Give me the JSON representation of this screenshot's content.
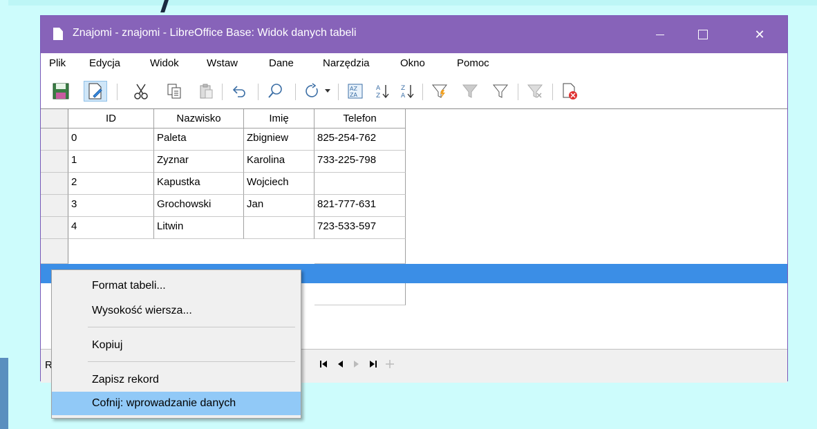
{
  "window": {
    "title": "Znajomi - znajomi - LibreOffice Base: Widok danych tabeli",
    "controls": {
      "minimize": "—",
      "maximize": "☐",
      "close": "✕"
    }
  },
  "menubar": {
    "items": [
      "Plik",
      "Edycja",
      "Widok",
      "Wstaw",
      "Dane",
      "Narzędzia",
      "Okno",
      "Pomoc"
    ]
  },
  "toolbar": {
    "icons": [
      "save-record-icon",
      "edit-data-icon",
      "cut-icon",
      "copy-icon",
      "paste-icon",
      "undo-icon",
      "find-icon",
      "refresh-icon",
      "dropdown-arrow-icon",
      "sort-icon",
      "sort-ascending-icon",
      "sort-descending-icon",
      "autofilter-icon",
      "apply-filter-icon",
      "standard-filter-icon",
      "reset-filter-icon",
      "delete-record-icon"
    ]
  },
  "table": {
    "columns": [
      "ID",
      "Nazwisko",
      "Imię",
      "Telefon"
    ],
    "rows": [
      [
        "0",
        "Paleta",
        "Zbigniew",
        "825-254-762"
      ],
      [
        "1",
        "Zyznar",
        "Karolina",
        "733-225-798"
      ],
      [
        "2",
        "Kapustka",
        "Wojciech",
        ""
      ],
      [
        "3",
        "Grochowski",
        "Jan",
        "821-777-631"
      ],
      [
        "4",
        "Litwin",
        "",
        "723-533-597"
      ]
    ]
  },
  "navigation": {
    "record_label": "R",
    "buttons": [
      "first-record-icon",
      "previous-record-icon",
      "next-record-icon",
      "last-record-icon",
      "new-record-icon"
    ]
  },
  "context_menu": {
    "items": [
      {
        "label": "Format tabeli...",
        "accel": "F"
      },
      {
        "label": "Wysokość wiersza...",
        "accel": "W"
      },
      {
        "label": "Kopiuj",
        "accel": "K"
      },
      {
        "label": "Zapisz rekord",
        "accel": "Z"
      },
      {
        "label": "Cofnij: wprowadzanie danych",
        "accel": "C",
        "highlighted": true
      }
    ]
  },
  "colors": {
    "titlebar": "#8763b9",
    "selection": "#3b8ee6",
    "menu_highlight": "#91c9f7",
    "background": "#cdfcfc"
  }
}
